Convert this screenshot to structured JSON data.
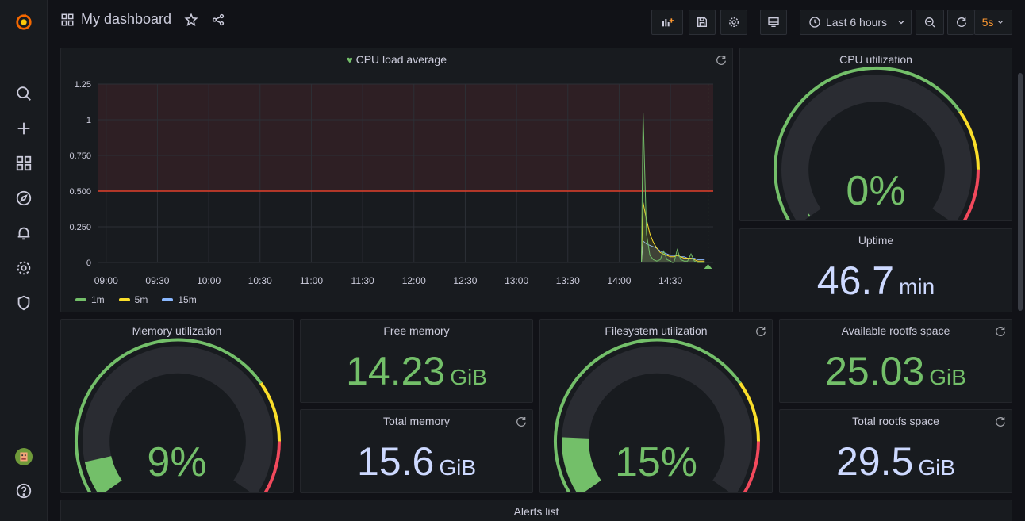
{
  "colors": {
    "green": "#73bf69",
    "yellow": "#fade2a",
    "orange": "#ff9830",
    "red": "#f2495c",
    "blue": "#cdd9ff",
    "threshold_line": "#e0402b",
    "cyan": "#5794f2",
    "light_cyan": "#8ab8ff"
  },
  "nav": {
    "title": "My dashboard",
    "time_range": "Last 6 hours",
    "refresh_interval": "5s"
  },
  "sidebar": {
    "icons": [
      "grafana-logo-icon",
      "search-icon",
      "plus-icon",
      "dashboards-icon",
      "explore-icon",
      "alert-bell-icon",
      "gear-icon",
      "shield-icon",
      "avatar",
      "help-icon"
    ]
  },
  "panels": {
    "cpu_load": {
      "title": "CPU load average"
    },
    "cpu_util": {
      "title": "CPU utilization",
      "value": "0%",
      "level": 0
    },
    "uptime": {
      "title": "Uptime",
      "value": "46.7",
      "unit": "min"
    },
    "mem_util": {
      "title": "Memory utilization",
      "value": "9%",
      "level": 0.09
    },
    "free_mem": {
      "title": "Free memory",
      "value": "14.23",
      "unit": "GiB"
    },
    "total_mem": {
      "title": "Total memory",
      "value": "15.6",
      "unit": "GiB"
    },
    "fs_util": {
      "title": "Filesystem utilization",
      "value": "15%",
      "level": 0.15
    },
    "avail_rootfs": {
      "title": "Available rootfs space",
      "value": "25.03",
      "unit": "GiB"
    },
    "total_rootfs": {
      "title": "Total rootfs space",
      "value": "29.5",
      "unit": "GiB"
    },
    "alerts": {
      "title": "Alerts list"
    }
  },
  "chart_data": {
    "type": "line",
    "title": "CPU load average",
    "x_ticks": [
      "09:00",
      "09:30",
      "10:00",
      "10:30",
      "11:00",
      "11:30",
      "12:00",
      "12:30",
      "13:00",
      "13:30",
      "14:00",
      "14:30"
    ],
    "y_ticks": [
      "0",
      "0.250",
      "0.500",
      "0.750",
      "1",
      "1.25"
    ],
    "ylim": [
      0,
      1.25
    ],
    "threshold": 0.5,
    "grid": true,
    "legend": "bottom-left",
    "series": [
      {
        "name": "1m",
        "color": "#73bf69",
        "x": [
          "14:13",
          "14:14",
          "14:16",
          "14:18",
          "14:20",
          "14:22",
          "14:24",
          "14:26",
          "14:28",
          "14:30",
          "14:31",
          "14:32",
          "14:34",
          "14:36",
          "14:38",
          "14:40",
          "14:42",
          "14:44",
          "14:46",
          "14:48",
          "14:50"
        ],
        "values": [
          0.0,
          1.05,
          0.2,
          0.05,
          0.02,
          0.01,
          0.02,
          0.08,
          0.02,
          0.01,
          0.0,
          0.0,
          0.09,
          0.02,
          0.01,
          0.01,
          0.06,
          0.01,
          0.0,
          0.0,
          0.0
        ]
      },
      {
        "name": "5m",
        "color": "#fade2a",
        "x": [
          "14:13",
          "14:14",
          "14:16",
          "14:18",
          "14:20",
          "14:22",
          "14:24",
          "14:26",
          "14:28",
          "14:30",
          "14:32",
          "14:34",
          "14:36",
          "14:38",
          "14:40",
          "14:42",
          "14:44",
          "14:46",
          "14:48",
          "14:50"
        ],
        "values": [
          0.0,
          0.42,
          0.3,
          0.2,
          0.14,
          0.1,
          0.07,
          0.06,
          0.05,
          0.04,
          0.04,
          0.05,
          0.04,
          0.03,
          0.03,
          0.03,
          0.02,
          0.01,
          0.01,
          0.01
        ]
      },
      {
        "name": "15m",
        "color": "#8ab8ff",
        "x": [
          "14:13",
          "14:14",
          "14:16",
          "14:18",
          "14:20",
          "14:22",
          "14:24",
          "14:26",
          "14:28",
          "14:30",
          "14:32",
          "14:34",
          "14:36",
          "14:38",
          "14:40",
          "14:42",
          "14:44",
          "14:46",
          "14:48",
          "14:50"
        ],
        "values": [
          0.0,
          0.15,
          0.13,
          0.12,
          0.11,
          0.1,
          0.08,
          0.07,
          0.06,
          0.05,
          0.05,
          0.05,
          0.04,
          0.04,
          0.03,
          0.03,
          0.03,
          0.02,
          0.02,
          0.02
        ]
      }
    ]
  }
}
